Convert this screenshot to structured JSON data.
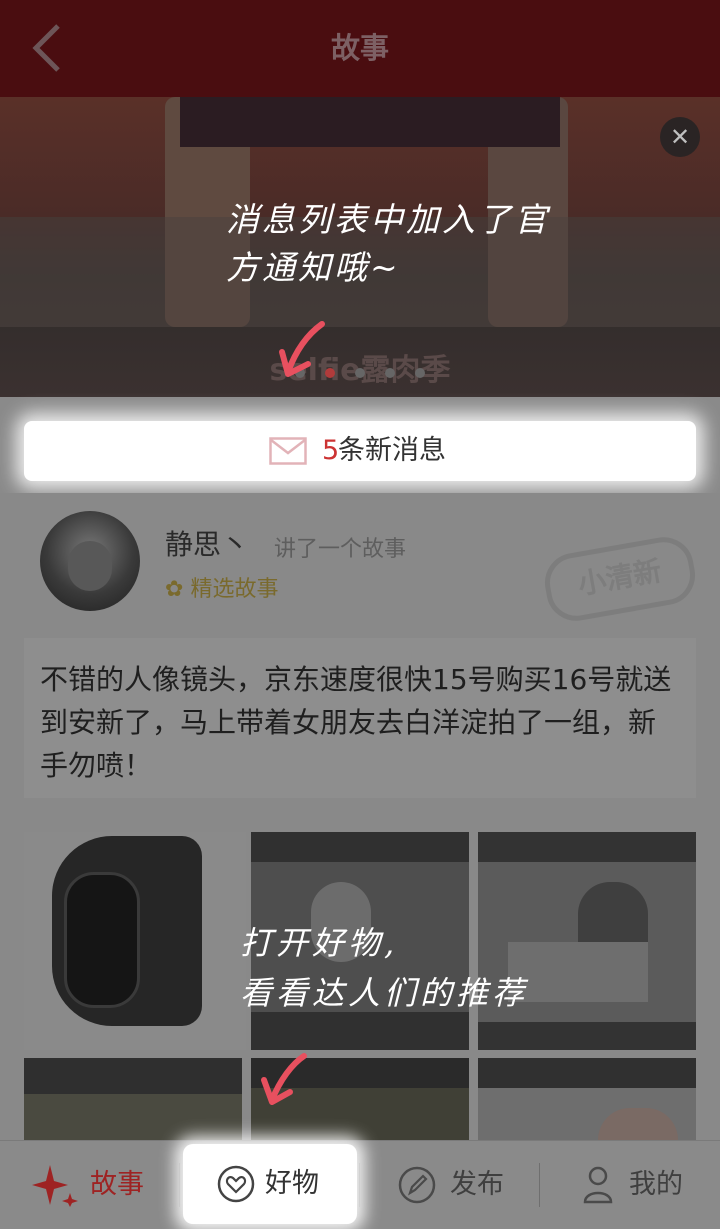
{
  "header": {
    "title": "故事",
    "back_icon": "back-arrow-icon"
  },
  "banner": {
    "caption": "selfie露肉季",
    "dot_count": 5,
    "active_dot": 2,
    "close_icon": "close-icon",
    "hint": "消息列表中加入了官方通知哦~"
  },
  "messages": {
    "count": "5",
    "label": "条新消息",
    "icon": "mail-icon"
  },
  "story": {
    "username": "静思丶",
    "action": "讲了一个故事",
    "badge": "精选故事",
    "stamp": "小清新",
    "text": "不错的人像镜头，京东速度很快15号购买16号就送到安新了，马上带着女朋友去白洋淀拍了一组，新手勿喷！"
  },
  "hint2": {
    "line1": "打开好物,",
    "line2": "看看达人们的推荐"
  },
  "tabs": [
    {
      "label": "故事",
      "icon": "sparkle-icon",
      "active": true
    },
    {
      "label": "好物",
      "icon": "heart-icon",
      "active": false
    },
    {
      "label": "发布",
      "icon": "edit-icon",
      "active": false
    },
    {
      "label": "我的",
      "icon": "user-icon",
      "active": false
    }
  ],
  "colors": {
    "topbar": "#4a0d10",
    "accent": "#c33333",
    "badge": "#7a6a2d"
  }
}
